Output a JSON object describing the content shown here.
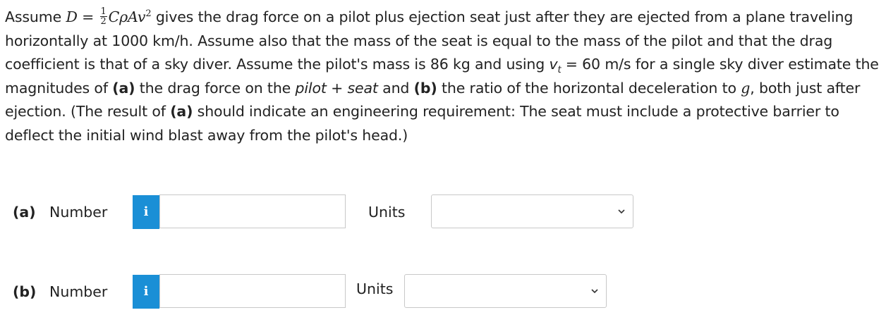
{
  "problem": {
    "intro": "Assume ",
    "eq_D": "D",
    "eq_equals": " = ",
    "eq_frac_num": "1",
    "eq_frac_den": "2",
    "eq_rest": "CρAv",
    "eq_exp": "2",
    "text1": " gives the drag force on a pilot plus ejection seat just after they are ejected from a plane traveling horizontally at 1000 km/h. Assume also that the mass of the seat is equal to the mass of the pilot and that the drag coefficient is that of a sky diver. Assume the pilot's mass is 86 kg and using ",
    "vt_v": "v",
    "vt_sub": "t",
    "text2": " = 60 m/s for a single sky diver estimate the magnitudes of ",
    "a_tag": "(a)",
    "text3": " the drag force on the ",
    "pilot_seat": "pilot + seat",
    "text4": " and ",
    "b_tag": "(b)",
    "text5": " the ratio of the horizontal deceleration to ",
    "g": "g",
    "text6": ", both just after ejection. (The result of ",
    "a_tag2": "(a)",
    "text7": " should indicate an engineering requirement: The seat must include a protective barrier to deflect the initial wind blast away from the pilot's head.)"
  },
  "answers": [
    {
      "part": "(a)",
      "number_label": "Number",
      "info_icon": "i",
      "number_value": "",
      "units_label": "Units",
      "units_selected": ""
    },
    {
      "part": "(b)",
      "number_label": "Number",
      "info_icon": "i",
      "number_value": "",
      "units_label": "Units",
      "units_selected": ""
    }
  ],
  "colors": {
    "info_button": "#1a8fd6",
    "border": "#c8c8c8",
    "text": "#222222"
  }
}
